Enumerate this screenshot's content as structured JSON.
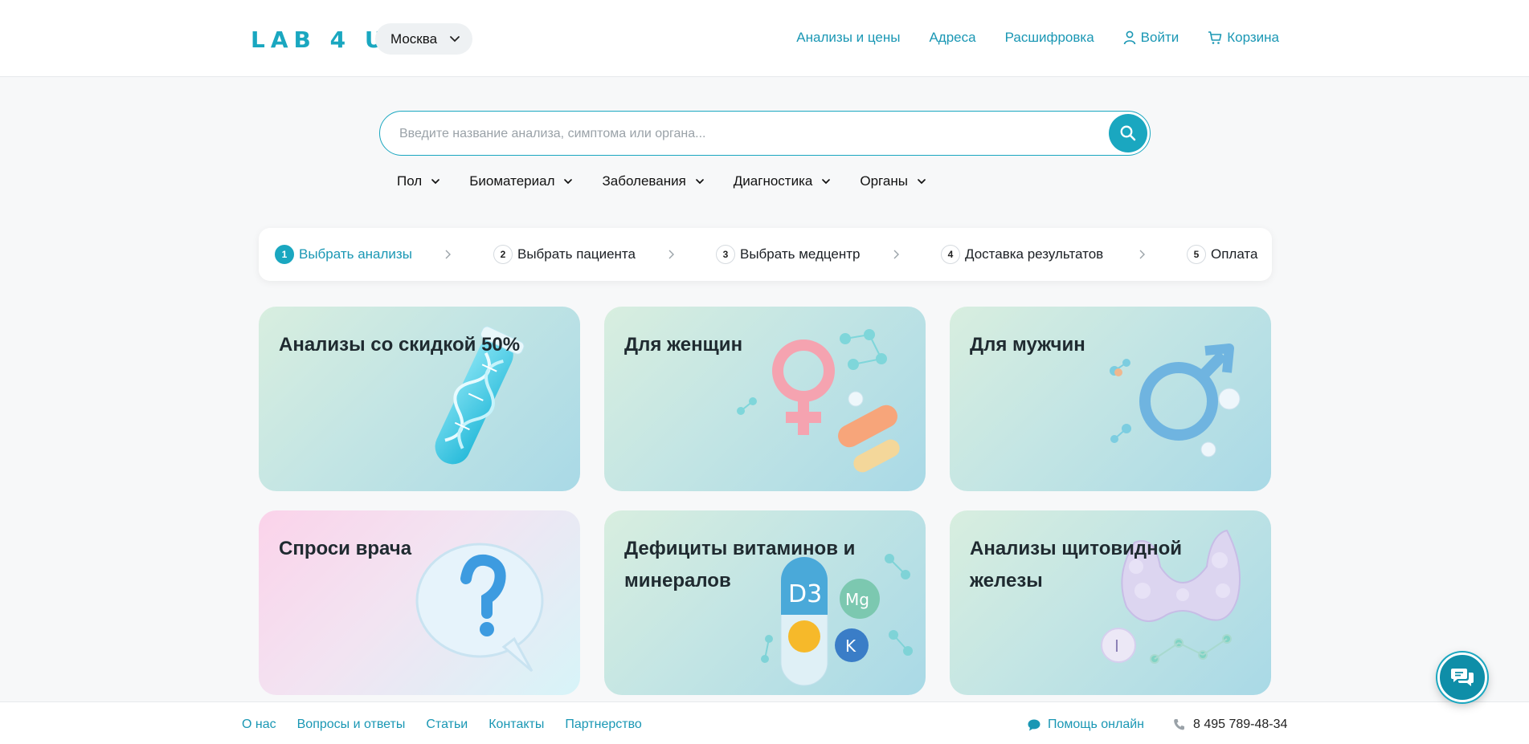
{
  "header": {
    "logo": "LAB 4 U",
    "city": "Москва",
    "nav": [
      {
        "label": "Анализы и цены"
      },
      {
        "label": "Адреса"
      },
      {
        "label": "Расшифровка"
      },
      {
        "label": "Войти",
        "icon": "user-icon"
      },
      {
        "label": "Корзина",
        "icon": "cart-icon"
      }
    ]
  },
  "search": {
    "placeholder": "Введите название анализа, симптома или органа...",
    "value": ""
  },
  "filters": [
    "Пол",
    "Биоматериал",
    "Заболевания",
    "Диагностика",
    "Органы"
  ],
  "steps": [
    {
      "num": "1",
      "label": "Выбрать анализы",
      "active": true
    },
    {
      "num": "2",
      "label": "Выбрать пациента"
    },
    {
      "num": "3",
      "label": "Выбрать медцентр"
    },
    {
      "num": "4",
      "label": "Доставка результатов"
    },
    {
      "num": "5",
      "label": "Оплата"
    }
  ],
  "cards": [
    {
      "title": "Анализы со скидкой 50%",
      "icon": "dna-test-tube-icon"
    },
    {
      "title": "Для женщин",
      "icon": "female-symbol-icon"
    },
    {
      "title": "Для мужчин",
      "icon": "male-symbol-icon"
    },
    {
      "title": "Спроси врача",
      "icon": "question-bubble-icon"
    },
    {
      "title": "Дефициты витаминов и минералов",
      "icon": "vitamins-icon",
      "art_labels": [
        "D3",
        "Mg",
        "K"
      ]
    },
    {
      "title": "Анализы щитовидной железы",
      "icon": "thyroid-icon",
      "art_labels": [
        "I"
      ]
    }
  ],
  "footer": {
    "links": [
      "О нас",
      "Вопросы и ответы",
      "Статьи",
      "Контакты",
      "Партнерство"
    ],
    "help": "Помощь онлайн",
    "phone": "8 495 789-48-34"
  },
  "colors": {
    "accent": "#1aa7c0",
    "link": "#1a97b4",
    "chat_button": "#0f8ea8"
  }
}
